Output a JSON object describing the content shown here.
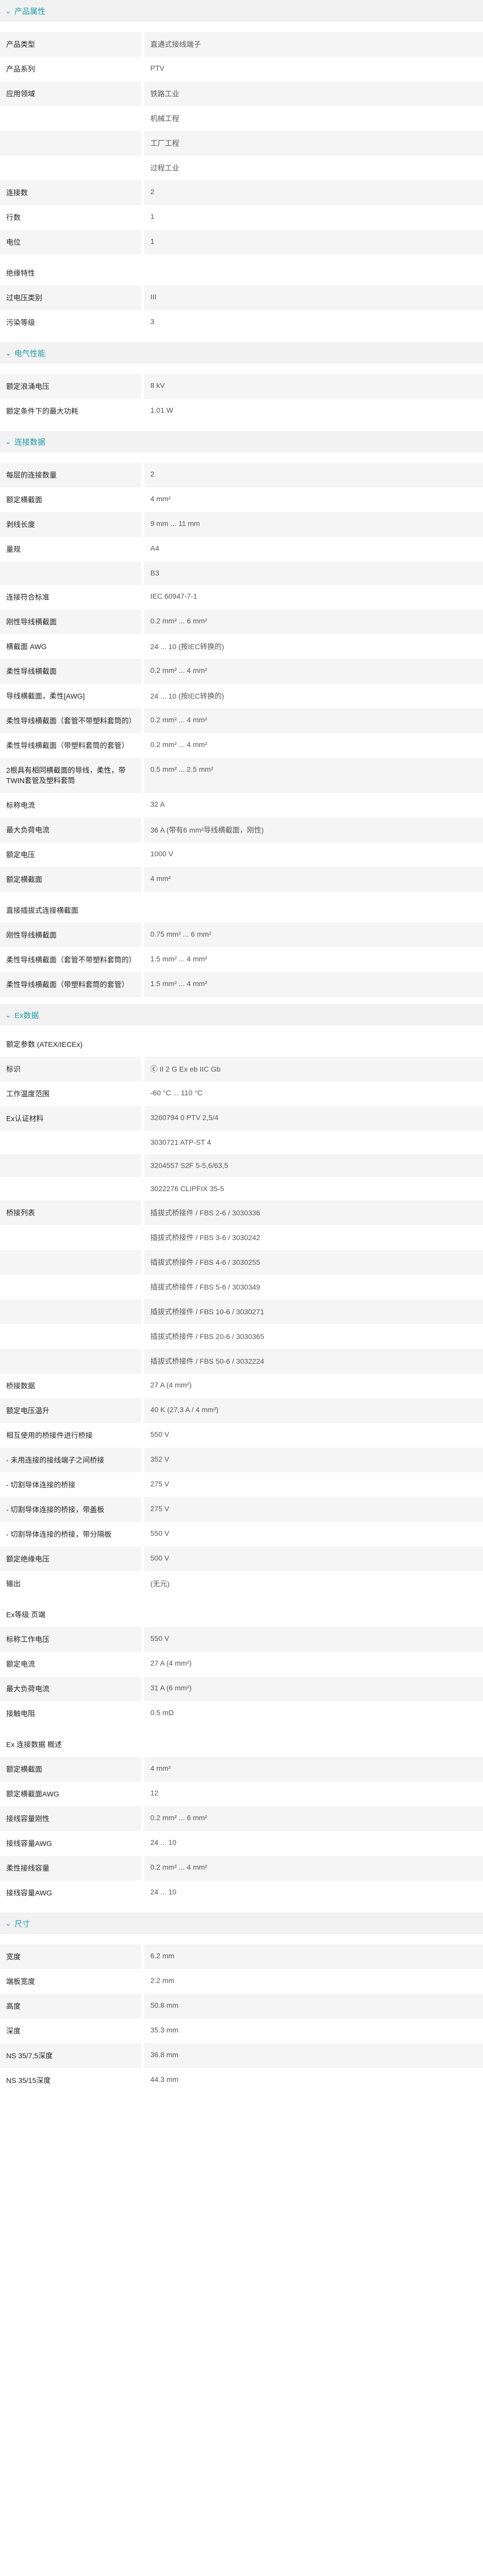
{
  "sections": [
    {
      "id": "product-info",
      "title": "产品属性",
      "rows": [
        {
          "label": "产品类型",
          "value": "直通式接线端子"
        },
        {
          "label": "产品系列",
          "value": "PTV"
        },
        {
          "label": "应用领域",
          "value": "铁路工业"
        },
        {
          "label": "",
          "value": "机械工程"
        },
        {
          "label": "",
          "value": "工厂工程"
        },
        {
          "label": "",
          "value": "过程工业"
        },
        {
          "label": "连接数",
          "value": "2"
        },
        {
          "label": "行数",
          "value": "1"
        },
        {
          "label": "电位",
          "value": "1"
        }
      ],
      "subgroups": [
        {
          "title": "绝缘特性",
          "rows": [
            {
              "label": "过电压类别",
              "value": "III"
            },
            {
              "label": "污染等级",
              "value": "3"
            }
          ]
        }
      ]
    },
    {
      "id": "electrical",
      "title": "电气性能",
      "rows": [
        {
          "label": "额定浪涌电压",
          "value": "8 kV"
        },
        {
          "label": "额定条件下的最大功耗",
          "value": "1.01 W"
        }
      ]
    },
    {
      "id": "connection",
      "title": "连接数据",
      "rows": [
        {
          "label": "每层的连接数量",
          "value": "2"
        },
        {
          "label": "额定横截面",
          "value": "4 mm²"
        },
        {
          "label": "剥线长度",
          "value": "9 mm ... 11 mm"
        },
        {
          "label": "量规",
          "value": "A4"
        },
        {
          "label": "",
          "value": "B3"
        },
        {
          "label": "连接符合标准",
          "value": "IEC 60947-7-1"
        },
        {
          "label": "刚性导线横截面",
          "value": "0.2 mm² ... 6 mm²"
        },
        {
          "label": "横截面 AWG",
          "value": "24 ... 10 (按IEC转换的)"
        },
        {
          "label": "柔性导线横截面",
          "value": "0.2 mm² ... 4 mm²"
        },
        {
          "label": "导线横截面，柔性[AWG]",
          "value": "24 ... 10 (按IEC转换的)"
        },
        {
          "label": "柔性导线横截面（套管不带塑料套筒的）",
          "value": "0.2 mm² ... 4 mm²"
        },
        {
          "label": "柔性导线横截面（带塑料套筒的套管）",
          "value": "0.2 mm² ... 4 mm²"
        },
        {
          "label": "2根具有相同横截面的导线，柔性，带TWIN套管及塑料套筒",
          "value": "0.5 mm² ... 2.5 mm²"
        },
        {
          "label": "标称电流",
          "value": "32 A"
        },
        {
          "label": "最大负荷电流",
          "value": "36 A (带有6 mm²导线横截面，刚性)"
        },
        {
          "label": "额定电压",
          "value": "1000 V"
        },
        {
          "label": "额定横截面",
          "value": "4 mm²"
        }
      ],
      "subgroups": [
        {
          "title": "直接插拔式连接横截面",
          "rows": [
            {
              "label": "刚性导线横截面",
              "value": "0.75 mm² ... 6 mm²"
            },
            {
              "label": "柔性导线横截面（套管不带塑料套筒的）",
              "value": "1.5 mm² ... 4 mm²"
            },
            {
              "label": "柔性导线横截面（带塑料套筒的套管）",
              "value": "1.5 mm² ... 4 mm²"
            }
          ]
        }
      ]
    },
    {
      "id": "ex",
      "title": "Ex数据",
      "intro": "额定参数 (ATEX/IECEx)",
      "rows": [
        {
          "label": "标识",
          "value": "Ⓔ II 2 G Ex eb IIC Gb"
        },
        {
          "label": "工作温度范围",
          "value": "-60 °C ... 110 °C"
        },
        {
          "label": "Ex认证材料",
          "value": "3260794 0 PTV 2,5/4"
        },
        {
          "label": "",
          "value": "3030721 ATP-ST 4"
        },
        {
          "label": "",
          "value": "3204557 S2F 5-5,6/63,5"
        },
        {
          "label": "",
          "value": "3022276 CLIPFIX 35-5"
        },
        {
          "label": "桥接列表",
          "value": "插拔式桥接件 / FBS 2-6 / 3030336"
        },
        {
          "label": "",
          "value": "插拔式桥接件 / FBS 3-6 / 3030242"
        },
        {
          "label": "",
          "value": "插拔式桥接件 / FBS 4-6 / 3030255"
        },
        {
          "label": "",
          "value": "插拔式桥接件 / FBS 5-6 / 3030349"
        },
        {
          "label": "",
          "value": "插拔式桥接件 / FBS 10-6 / 3030271"
        },
        {
          "label": "",
          "value": "插拔式桥接件 / FBS 20-6 / 3030365"
        },
        {
          "label": "",
          "value": "插拔式桥接件 / FBS 50-6 / 3032224"
        },
        {
          "label": "桥接数据",
          "value": "27 A (4 mm²)"
        },
        {
          "label": "额定电压温升",
          "value": "40 K (27,3 A / 4 mm²)"
        },
        {
          "label": "相互使用的桥接件进行桥接",
          "value": "550 V"
        },
        {
          "label": "- 未用连接的接线端子之间桥接",
          "value": "352 V"
        },
        {
          "label": "- 切割导体连接的桥接",
          "value": "275 V"
        },
        {
          "label": "- 切割导体连接的桥接，带盖板",
          "value": "275 V"
        },
        {
          "label": "- 切割导体连接的桥接，带分隔板",
          "value": "550 V"
        },
        {
          "label": "额定绝缘电压",
          "value": "500 V"
        },
        {
          "label": "输出",
          "value": "(无元)"
        }
      ],
      "subgroups": [
        {
          "title": "Ex等级 页端",
          "rows": [
            {
              "label": "标称工作电压",
              "value": "550 V"
            },
            {
              "label": "额定电流",
              "value": "27 A (4 mm²)"
            },
            {
              "label": "最大负荷电流",
              "value": "31 A (6 mm²)"
            },
            {
              "label": "接触电阻",
              "value": "0.5 mΩ"
            }
          ]
        },
        {
          "title": "Ex 连接数据 概述",
          "rows": [
            {
              "label": "额定横截面",
              "value": "4 mm²"
            },
            {
              "label": "额定横截面AWG",
              "value": "12"
            },
            {
              "label": "接线容量刚性",
              "value": "0.2 mm² ... 6 mm²"
            },
            {
              "label": "接线容量AWG",
              "value": "24 ... 10"
            },
            {
              "label": "柔性接线容量",
              "value": "0.2 mm² ... 4 mm²"
            },
            {
              "label": "接线容量AWG",
              "value": "24 ... 10"
            }
          ]
        }
      ]
    },
    {
      "id": "dimensions",
      "title": "尺寸",
      "rows": [
        {
          "label": "宽度",
          "value": "6.2 mm"
        },
        {
          "label": "端板宽度",
          "value": "2.2 mm"
        },
        {
          "label": "高度",
          "value": "50.8 mm"
        },
        {
          "label": "深度",
          "value": "35.3 mm"
        },
        {
          "label": "NS 35/7,5深度",
          "value": "36.8 mm"
        },
        {
          "label": "NS 35/15深度",
          "value": "44.3 mm"
        }
      ]
    }
  ]
}
